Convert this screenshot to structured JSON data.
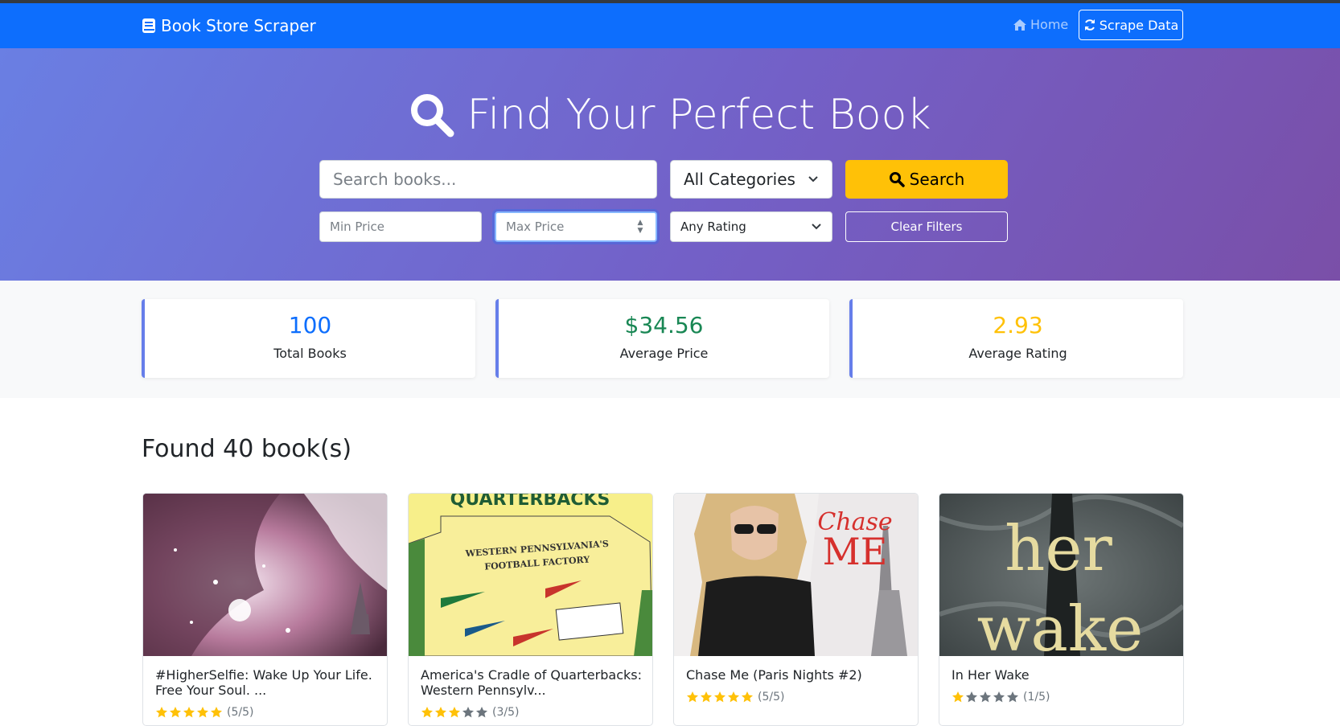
{
  "navbar": {
    "brand": "Book Store Scraper",
    "home_label": "Home",
    "scrape_label": "Scrape Data",
    "color": "#0d6efd"
  },
  "hero": {
    "title": "Find Your Perfect Book",
    "search_placeholder": "Search books...",
    "category_selected": "All Categories",
    "search_button": "Search",
    "min_price_placeholder": "Min Price",
    "max_price_placeholder": "Max Price",
    "rating_selected": "Any Rating",
    "clear_button": "Clear Filters"
  },
  "stats": {
    "total_books": "100",
    "total_books_label": "Total Books",
    "average_price": "$34.56",
    "average_price_label": "Average Price",
    "average_rating": "2.93",
    "average_rating_label": "Average Rating",
    "colors": {
      "total": "#0d6efd",
      "price": "#198754",
      "rating": "#ffc107"
    }
  },
  "results": {
    "heading": "Found 40 book(s)",
    "books": [
      {
        "title": "#HigherSelfie: Wake Up Your Life. Free Your Soul. ...",
        "rating": 5,
        "rating_text": "(5/5)"
      },
      {
        "title": "America's Cradle of Quarterbacks: Western Pennsylv...",
        "rating": 3,
        "rating_text": "(3/5)"
      },
      {
        "title": "Chase Me (Paris Nights #2)",
        "rating": 5,
        "rating_text": "(5/5)"
      },
      {
        "title": "In Her Wake",
        "rating": 1,
        "rating_text": "(1/5)"
      }
    ]
  },
  "cover_text": {
    "book2_banner": "QUARTERBACKS",
    "book2_sub1": "WESTERN PENNSYLVANIA'S",
    "book2_sub2": "FOOTBALL FACTORY",
    "book3_word1": "Chase",
    "book3_word2": "ME",
    "book4_word1": "her",
    "book4_word2": "wake"
  }
}
